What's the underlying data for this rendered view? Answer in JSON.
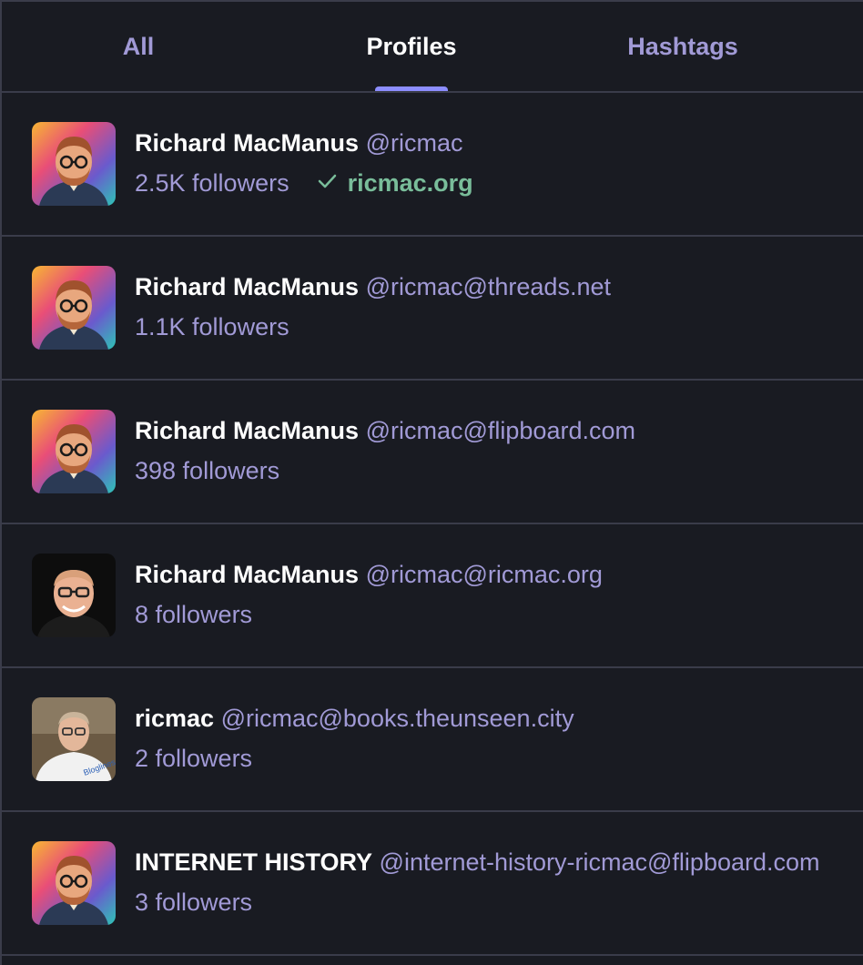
{
  "tabs": [
    {
      "label": "All",
      "active": false
    },
    {
      "label": "Profiles",
      "active": true
    },
    {
      "label": "Hashtags",
      "active": false
    }
  ],
  "colors": {
    "background": "#191b22",
    "accent": "#8c8dff",
    "muted_text": "#a19ad6",
    "verified": "#79bd9a"
  },
  "results": [
    {
      "display_name": "Richard MacManus",
      "handle": "@ricmac",
      "followers": "2.5K followers",
      "verified_link": "ricmac.org",
      "avatar": "illustrated-avatar"
    },
    {
      "display_name": "Richard MacManus",
      "handle": "@ricmac@threads.net",
      "followers": "1.1K followers",
      "avatar": "illustrated-avatar"
    },
    {
      "display_name": "Richard MacManus",
      "handle": "@ricmac@flipboard.com",
      "followers": "398 followers",
      "avatar": "illustrated-avatar"
    },
    {
      "display_name": "Richard MacManus",
      "handle": "@ricmac@ricmac.org",
      "followers": "8 followers",
      "avatar": "photo-avatar-dark"
    },
    {
      "display_name": "ricmac",
      "handle": "@ricmac@books.theunseen.city",
      "followers": "2 followers",
      "avatar": "photo-avatar-tshirt"
    },
    {
      "display_name": "INTERNET HISTORY",
      "handle": "@internet-history-ricmac@flipboard.com",
      "followers": "3 followers",
      "avatar": "illustrated-avatar"
    }
  ]
}
